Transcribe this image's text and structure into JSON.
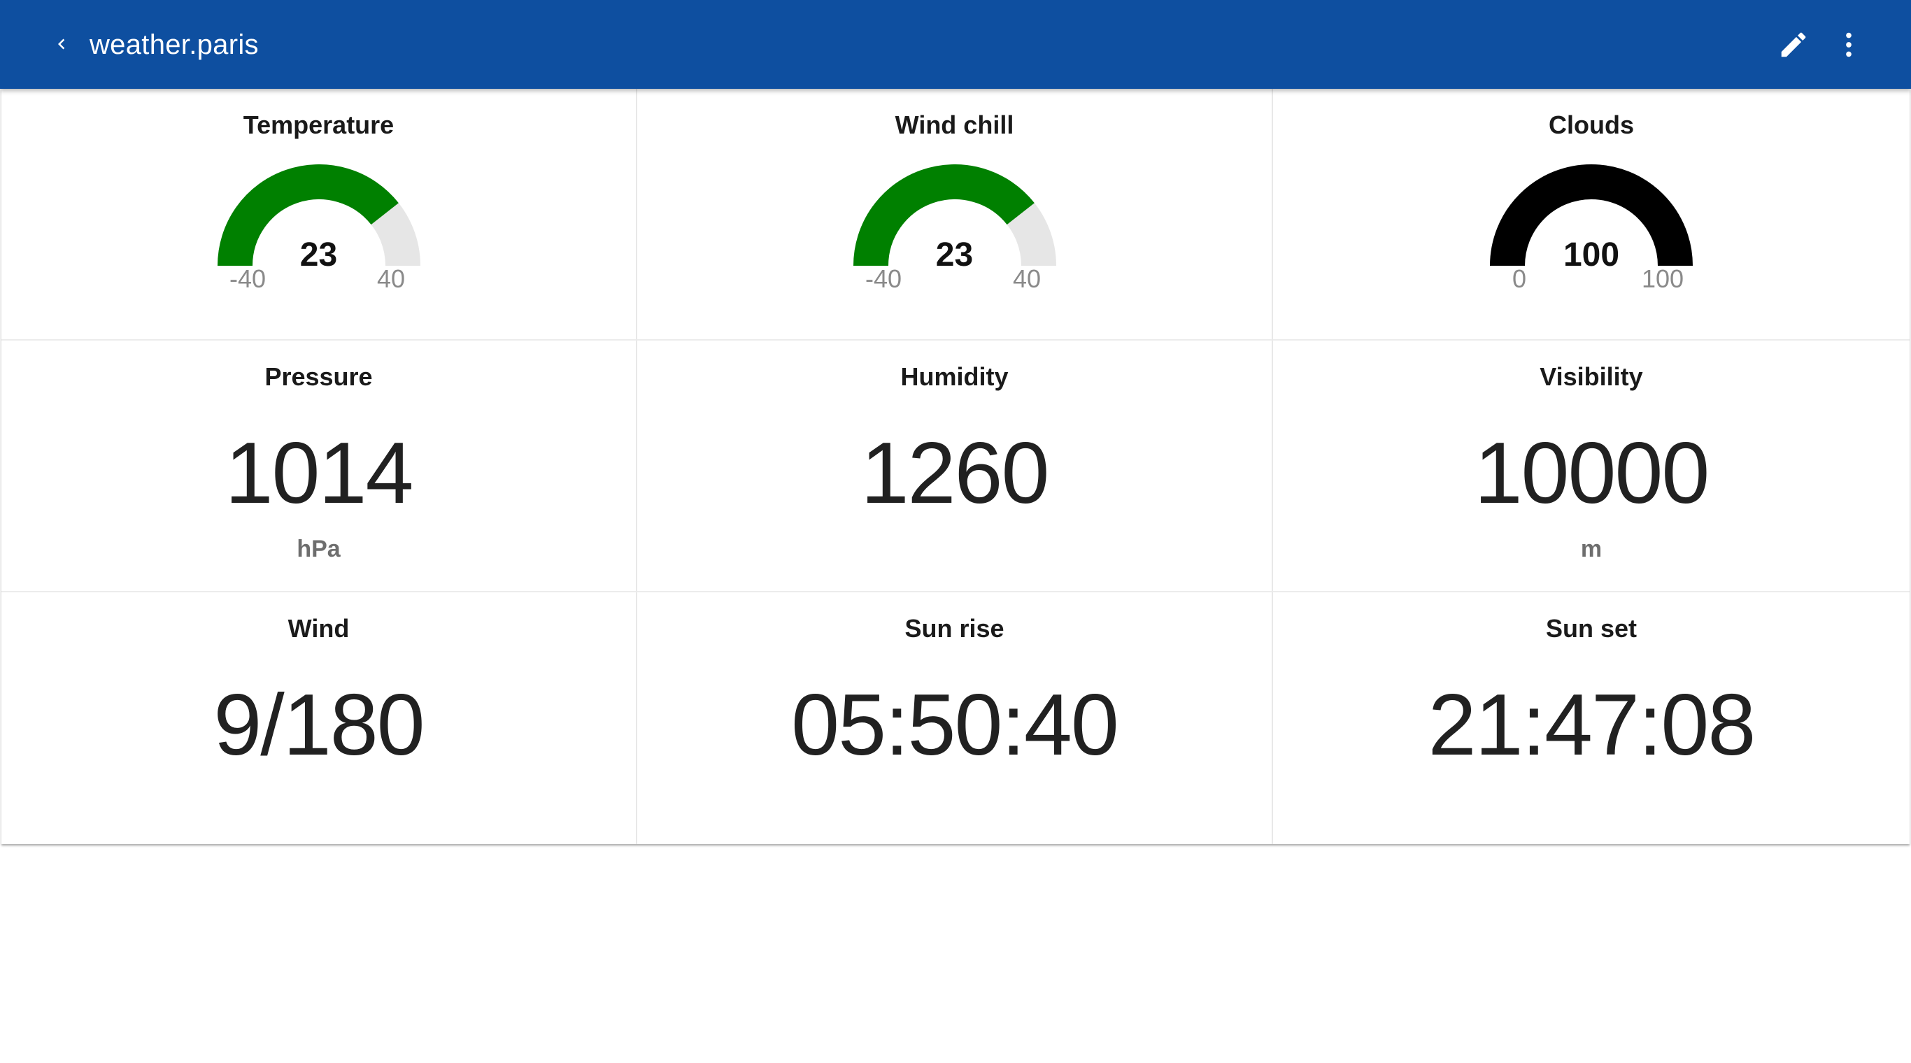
{
  "header": {
    "title": "weather.paris",
    "back_icon": "chevron-left-icon",
    "edit_icon": "pencil-icon",
    "menu_icon": "more-vertical-icon",
    "color": "#0e4fa0"
  },
  "gauges": [
    {
      "title": "Temperature",
      "value": "23",
      "min": "-40",
      "max": "40",
      "fraction": 0.7875,
      "color": "#008000"
    },
    {
      "title": "Wind chill",
      "value": "23",
      "min": "-40",
      "max": "40",
      "fraction": 0.7875,
      "color": "#008000"
    },
    {
      "title": "Clouds",
      "value": "100",
      "min": "0",
      "max": "100",
      "fraction": 1.0,
      "color": "#000000"
    }
  ],
  "values": [
    {
      "title": "Pressure",
      "value": "1014",
      "unit": "hPa"
    },
    {
      "title": "Humidity",
      "value": "1260",
      "unit": ""
    },
    {
      "title": "Visibility",
      "value": "10000",
      "unit": "m"
    },
    {
      "title": "Wind",
      "value": "9/180",
      "unit": ""
    },
    {
      "title": "Sun rise",
      "value": "05:50:40",
      "unit": ""
    },
    {
      "title": "Sun set",
      "value": "21:47:08",
      "unit": ""
    }
  ],
  "colors": {
    "gauge_track": "#e6e6e6"
  }
}
